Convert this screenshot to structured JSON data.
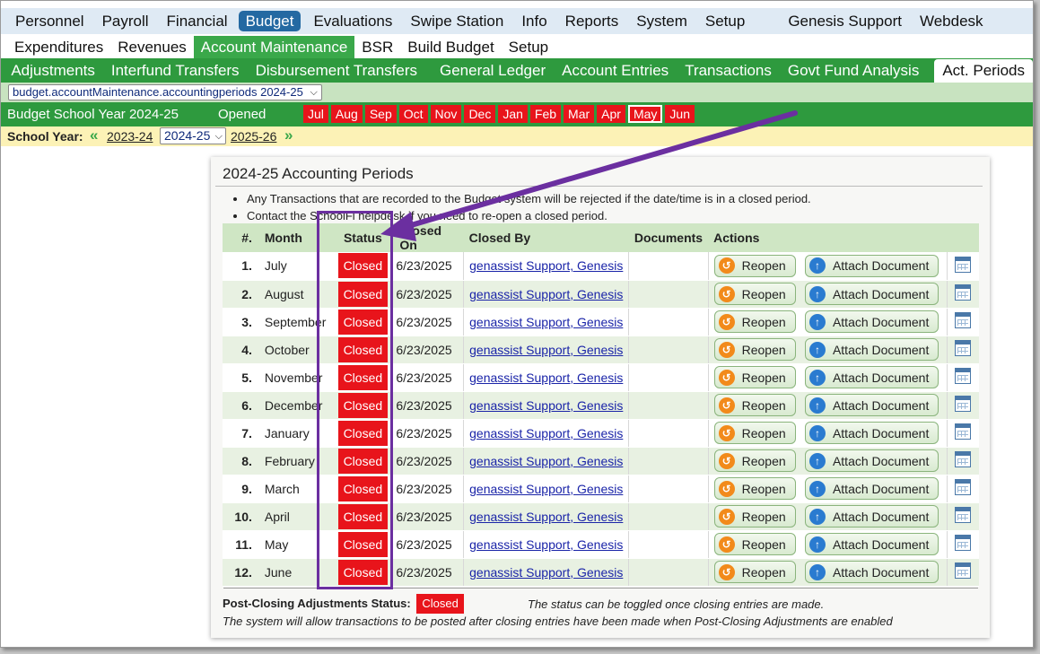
{
  "menu_top": [
    "Personnel",
    "Payroll",
    "Financial",
    "Budget",
    "Evaluations",
    "Swipe Station",
    "Info",
    "Reports",
    "System",
    "Setup"
  ],
  "menu_top_right": [
    "Genesis Support",
    "Webdesk"
  ],
  "menu_second": [
    "Expenditures",
    "Revenues",
    "Account Maintenance",
    "BSR",
    "Build Budget",
    "Setup"
  ],
  "menu_third_left": [
    "Adjustments",
    "Interfund Transfers",
    "Disbursement Transfers"
  ],
  "menu_third_right": [
    "General Ledger",
    "Account Entries",
    "Transactions",
    "Govt Fund Analysis",
    "Act. Periods"
  ],
  "path_select": "budget.accountMaintenance.accountingperiods 2024-25",
  "year_bar": {
    "label": "Budget School Year 2024-25",
    "status": "Opened",
    "months": [
      "Jul",
      "Aug",
      "Sep",
      "Oct",
      "Nov",
      "Dec",
      "Jan",
      "Feb",
      "Mar",
      "Apr",
      "May",
      "Jun"
    ]
  },
  "school_year": {
    "label": "School Year:",
    "prev": "2023-24",
    "current": "2024-25",
    "next": "2025-26"
  },
  "panel": {
    "title": "2024-25 Accounting Periods",
    "notes": [
      "Any Transactions that are recorded to the Budget system will be rejected if the date/time is in a closed period.",
      "Contact the SchoolFi helpdesk if you need to re-open a closed period."
    ],
    "headers": [
      "#.",
      "Month",
      "Status",
      "Closed On",
      "Closed By",
      "Documents",
      "Actions"
    ],
    "rows": [
      {
        "num": "1.",
        "month": "July",
        "status": "Closed",
        "closed_on": "6/23/2025",
        "closed_by": "genassist Support, Genesis"
      },
      {
        "num": "2.",
        "month": "August",
        "status": "Closed",
        "closed_on": "6/23/2025",
        "closed_by": "genassist Support, Genesis"
      },
      {
        "num": "3.",
        "month": "September",
        "status": "Closed",
        "closed_on": "6/23/2025",
        "closed_by": "genassist Support, Genesis"
      },
      {
        "num": "4.",
        "month": "October",
        "status": "Closed",
        "closed_on": "6/23/2025",
        "closed_by": "genassist Support, Genesis"
      },
      {
        "num": "5.",
        "month": "November",
        "status": "Closed",
        "closed_on": "6/23/2025",
        "closed_by": "genassist Support, Genesis"
      },
      {
        "num": "6.",
        "month": "December",
        "status": "Closed",
        "closed_on": "6/23/2025",
        "closed_by": "genassist Support, Genesis"
      },
      {
        "num": "7.",
        "month": "January",
        "status": "Closed",
        "closed_on": "6/23/2025",
        "closed_by": "genassist Support, Genesis"
      },
      {
        "num": "8.",
        "month": "February",
        "status": "Closed",
        "closed_on": "6/23/2025",
        "closed_by": "genassist Support, Genesis"
      },
      {
        "num": "9.",
        "month": "March",
        "status": "Closed",
        "closed_on": "6/23/2025",
        "closed_by": "genassist Support, Genesis"
      },
      {
        "num": "10.",
        "month": "April",
        "status": "Closed",
        "closed_on": "6/23/2025",
        "closed_by": "genassist Support, Genesis"
      },
      {
        "num": "11.",
        "month": "May",
        "status": "Closed",
        "closed_on": "6/23/2025",
        "closed_by": "genassist Support, Genesis"
      },
      {
        "num": "12.",
        "month": "June",
        "status": "Closed",
        "closed_on": "6/23/2025",
        "closed_by": "genassist Support, Genesis"
      }
    ],
    "reopen_label": "Reopen",
    "attach_label": "Attach Document",
    "post_closing_label": "Post-Closing Adjustments Status:",
    "post_closing_status": "Closed",
    "toggle_note": "The status can be toggled once closing entries are made.",
    "footer_note": "The system will allow transactions to be posted after closing entries have been made when Post-Closing Adjustments are enabled"
  },
  "colors": {
    "menu_active": "#2469a2",
    "green_bar": "#2e9a3e",
    "closed_red": "#e8141b",
    "annotation_purple": "#6b2fa0"
  }
}
